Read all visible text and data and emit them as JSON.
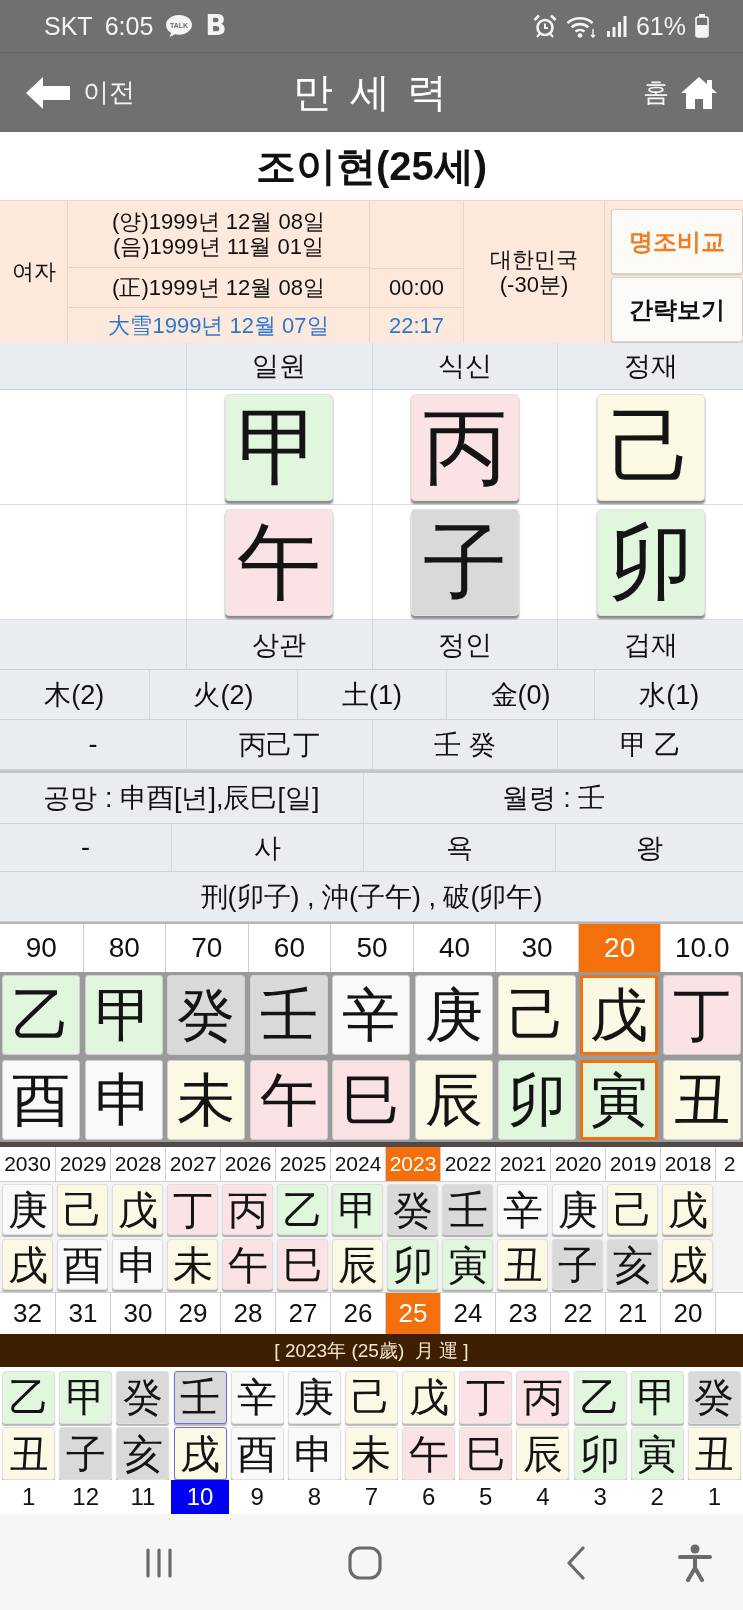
{
  "status_bar": {
    "carrier": "SKT",
    "time": "6:05",
    "notifications": [
      {
        "kind": "chat",
        "label": "TALK"
      },
      {
        "kind": "letter",
        "label": "B"
      }
    ],
    "battery": "61%"
  },
  "header": {
    "back": "이전",
    "title": "만 세 력",
    "home": "홈"
  },
  "person": {
    "title": "조이현(25세)"
  },
  "birth_info": {
    "gender": "여자",
    "solar": "(양)1999년 12월 08일",
    "lunar": "(음)1999년 11월 01일",
    "corrected": "(正)1999년 12월 08일",
    "corrected_time": "00:00",
    "solar_term": "大雪1999년 12월 07일",
    "solar_term_time": "22:17",
    "region": "대한민국",
    "offset": "(-30분)",
    "buttons": [
      {
        "kind": "highlight",
        "label": "명조비교"
      },
      {
        "kind": "plain",
        "label": "간략보기"
      }
    ]
  },
  "pillars": {
    "columns": [
      {
        "kind": "empty"
      },
      {
        "kind": "filled",
        "top_label": "일원",
        "stem": {
          "char": "甲",
          "color": "#e0f6dd"
        },
        "branch": {
          "char": "午",
          "color": "#fbe3e5"
        },
        "bottom_label": "상관"
      },
      {
        "kind": "filled",
        "top_label": "식신",
        "stem": {
          "char": "丙",
          "color": "#fbe3e5"
        },
        "branch": {
          "char": "子",
          "color": "#d9d9d9"
        },
        "bottom_label": "정인"
      },
      {
        "kind": "filled",
        "top_label": "정재",
        "stem": {
          "char": "己",
          "color": "#fbf8e3"
        },
        "branch": {
          "char": "卯",
          "color": "#e0f6dd"
        },
        "bottom_label": "겁재"
      }
    ],
    "elements": [
      "木(2)",
      "火(2)",
      "土(1)",
      "金(0)",
      "水(1)"
    ],
    "hidden_stems": [
      "-",
      "丙己丁",
      "壬 癸",
      "甲 乙"
    ],
    "gongmang": "공망 : 申酉[년],辰巳[일]",
    "month_command": "월령 : 壬",
    "stages": [
      "-",
      "사",
      "욕",
      "왕"
    ],
    "relations": "刑(卯子) , 沖(子午) , 破(卯午)"
  },
  "daewoon": [
    {
      "age": "90",
      "stem": {
        "char": "乙",
        "color": "#e0f6dd"
      },
      "branch": {
        "char": "酉",
        "color": "#f9f9f9"
      },
      "selected": false
    },
    {
      "age": "80",
      "stem": {
        "char": "甲",
        "color": "#e0f6dd"
      },
      "branch": {
        "char": "申",
        "color": "#f9f9f9"
      },
      "selected": false
    },
    {
      "age": "70",
      "stem": {
        "char": "癸",
        "color": "#d9d9d9"
      },
      "branch": {
        "char": "未",
        "color": "#fbf8e3"
      },
      "selected": false
    },
    {
      "age": "60",
      "stem": {
        "char": "壬",
        "color": "#d9d9d9"
      },
      "branch": {
        "char": "午",
        "color": "#fbe3e5"
      },
      "selected": false
    },
    {
      "age": "50",
      "stem": {
        "char": "辛",
        "color": "#f9f9f9"
      },
      "branch": {
        "char": "巳",
        "color": "#fbe3e5"
      },
      "selected": false
    },
    {
      "age": "40",
      "stem": {
        "char": "庚",
        "color": "#f9f9f9"
      },
      "branch": {
        "char": "辰",
        "color": "#fbf8e3"
      },
      "selected": false
    },
    {
      "age": "30",
      "stem": {
        "char": "己",
        "color": "#fbf8e3"
      },
      "branch": {
        "char": "卯",
        "color": "#e0f6dd"
      },
      "selected": false
    },
    {
      "age": "20",
      "stem": {
        "char": "戊",
        "color": "#fbf8e3"
      },
      "branch": {
        "char": "寅",
        "color": "#e0f6dd"
      },
      "selected": true
    },
    {
      "age": "10.0",
      "stem": {
        "char": "丁",
        "color": "#fbe3e5"
      },
      "branch": {
        "char": "丑",
        "color": "#fbf8e3"
      },
      "selected": false
    }
  ],
  "yearly": {
    "years": [
      {
        "year": "2030",
        "stem": {
          "char": "庚",
          "color": "#f9f9f9"
        },
        "branch": {
          "char": "戌",
          "color": "#fbf8e3"
        },
        "age": "32",
        "selected": false
      },
      {
        "year": "2029",
        "stem": {
          "char": "己",
          "color": "#fbf8e3"
        },
        "branch": {
          "char": "酉",
          "color": "#f9f9f9"
        },
        "age": "31",
        "selected": false
      },
      {
        "year": "2028",
        "stem": {
          "char": "戊",
          "color": "#fbf8e3"
        },
        "branch": {
          "char": "申",
          "color": "#f9f9f9"
        },
        "age": "30",
        "selected": false
      },
      {
        "year": "2027",
        "stem": {
          "char": "丁",
          "color": "#fbe3e5"
        },
        "branch": {
          "char": "未",
          "color": "#fbf8e3"
        },
        "age": "29",
        "selected": false
      },
      {
        "year": "2026",
        "stem": {
          "char": "丙",
          "color": "#fbe3e5"
        },
        "branch": {
          "char": "午",
          "color": "#fbe3e5"
        },
        "age": "28",
        "selected": false
      },
      {
        "year": "2025",
        "stem": {
          "char": "乙",
          "color": "#e0f6dd"
        },
        "branch": {
          "char": "巳",
          "color": "#fbe3e5"
        },
        "age": "27",
        "selected": false
      },
      {
        "year": "2024",
        "stem": {
          "char": "甲",
          "color": "#e0f6dd"
        },
        "branch": {
          "char": "辰",
          "color": "#fbf8e3"
        },
        "age": "26",
        "selected": false
      },
      {
        "year": "2023",
        "stem": {
          "char": "癸",
          "color": "#d9d9d9"
        },
        "branch": {
          "char": "卯",
          "color": "#e0f6dd"
        },
        "age": "25",
        "selected": true
      },
      {
        "year": "2022",
        "stem": {
          "char": "壬",
          "color": "#d9d9d9"
        },
        "branch": {
          "char": "寅",
          "color": "#e0f6dd"
        },
        "age": "24",
        "selected": false
      },
      {
        "year": "2021",
        "stem": {
          "char": "辛",
          "color": "#f9f9f9"
        },
        "branch": {
          "char": "丑",
          "color": "#fbf8e3"
        },
        "age": "23",
        "selected": false
      },
      {
        "year": "2020",
        "stem": {
          "char": "庚",
          "color": "#f9f9f9"
        },
        "branch": {
          "char": "子",
          "color": "#d9d9d9"
        },
        "age": "22",
        "selected": false
      },
      {
        "year": "2019",
        "stem": {
          "char": "己",
          "color": "#fbf8e3"
        },
        "branch": {
          "char": "亥",
          "color": "#d9d9d9"
        },
        "age": "21",
        "selected": false
      },
      {
        "year": "2018",
        "stem": {
          "char": "戊",
          "color": "#fbf8e3"
        },
        "branch": {
          "char": "戌",
          "color": "#fbf8e3"
        },
        "age": "20",
        "selected": false
      }
    ],
    "cut_off_year": "2"
  },
  "monthly": {
    "title": "[ 2023年 (25歲)  月 運 ]",
    "months": [
      {
        "month": "1",
        "stem": {
          "char": "乙",
          "color": "#e0f6dd"
        },
        "branch": {
          "char": "丑",
          "color": "#fbf8e3"
        },
        "selected": false
      },
      {
        "month": "12",
        "stem": {
          "char": "甲",
          "color": "#e0f6dd"
        },
        "branch": {
          "char": "子",
          "color": "#d9d9d9"
        },
        "selected": false
      },
      {
        "month": "11",
        "stem": {
          "char": "癸",
          "color": "#d9d9d9"
        },
        "branch": {
          "char": "亥",
          "color": "#d9d9d9"
        },
        "selected": false
      },
      {
        "month": "10",
        "stem": {
          "char": "壬",
          "color": "#d9d9d9"
        },
        "branch": {
          "char": "戌",
          "color": "#fbf8e3"
        },
        "selected": true
      },
      {
        "month": "9",
        "stem": {
          "char": "辛",
          "color": "#f9f9f9"
        },
        "branch": {
          "char": "酉",
          "color": "#f9f9f9"
        },
        "selected": false
      },
      {
        "month": "8",
        "stem": {
          "char": "庚",
          "color": "#f9f9f9"
        },
        "branch": {
          "char": "申",
          "color": "#f9f9f9"
        },
        "selected": false
      },
      {
        "month": "7",
        "stem": {
          "char": "己",
          "color": "#fbf8e3"
        },
        "branch": {
          "char": "未",
          "color": "#fbf8e3"
        },
        "selected": false
      },
      {
        "month": "6",
        "stem": {
          "char": "戊",
          "color": "#fbf8e3"
        },
        "branch": {
          "char": "午",
          "color": "#fbe3e5"
        },
        "selected": false
      },
      {
        "month": "5",
        "stem": {
          "char": "丁",
          "color": "#fbe3e5"
        },
        "branch": {
          "char": "巳",
          "color": "#fbe3e5"
        },
        "selected": false
      },
      {
        "month": "4",
        "stem": {
          "char": "丙",
          "color": "#fbe3e5"
        },
        "branch": {
          "char": "辰",
          "color": "#fbf8e3"
        },
        "selected": false
      },
      {
        "month": "3",
        "stem": {
          "char": "乙",
          "color": "#e0f6dd"
        },
        "branch": {
          "char": "卯",
          "color": "#e0f6dd"
        },
        "selected": false
      },
      {
        "month": "2",
        "stem": {
          "char": "甲",
          "color": "#e0f6dd"
        },
        "branch": {
          "char": "寅",
          "color": "#e0f6dd"
        },
        "selected": false
      },
      {
        "month": "1",
        "stem": {
          "char": "癸",
          "color": "#d9d9d9"
        },
        "branch": {
          "char": "丑",
          "color": "#fbf8e3"
        },
        "selected": false
      }
    ]
  }
}
